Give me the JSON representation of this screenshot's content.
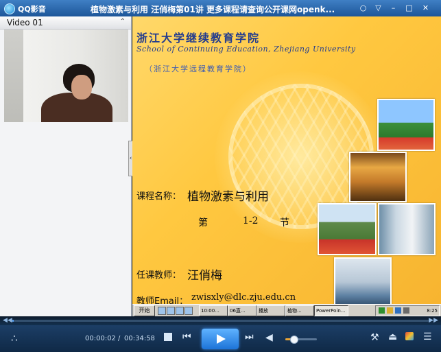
{
  "window": {
    "app_name": "QQ影音",
    "title": "植物激素与利用 汪俏梅第01讲  更多课程请查询公开课网openk..."
  },
  "video_pane": {
    "title": "Video 01"
  },
  "slide": {
    "school_cn": "浙江大学继续教育学院",
    "school_en": "School of Continuing Education, Zhejiang University",
    "school_sub": "（浙江大学远程教育学院）",
    "course_label": "课程名称：",
    "course_value": "植物激素与利用",
    "section_di": "第",
    "section_num": "1-2",
    "section_jie": "节",
    "teacher_label": "任课教师：",
    "teacher_value": "汪俏梅",
    "email_label": "教师Email：",
    "email_value": "zwisxly@dlc.zju.edu.cn"
  },
  "embedded_taskbar": {
    "start_label": "开始",
    "tasks": [
      "10:00...",
      "06直...",
      "播放",
      "植物...",
      "PowerPoin..."
    ],
    "clock": "8:25"
  },
  "player": {
    "time_current": "00:00:02",
    "time_separator": "/",
    "time_total": "00:34:58",
    "progress_fraction": 0.001,
    "volume_fraction": 0.25
  },
  "colors": {
    "accent": "#3a8be6",
    "titlebar": "#2a67ad",
    "slide_background": "#ffc840",
    "school_text": "#233c8e"
  }
}
